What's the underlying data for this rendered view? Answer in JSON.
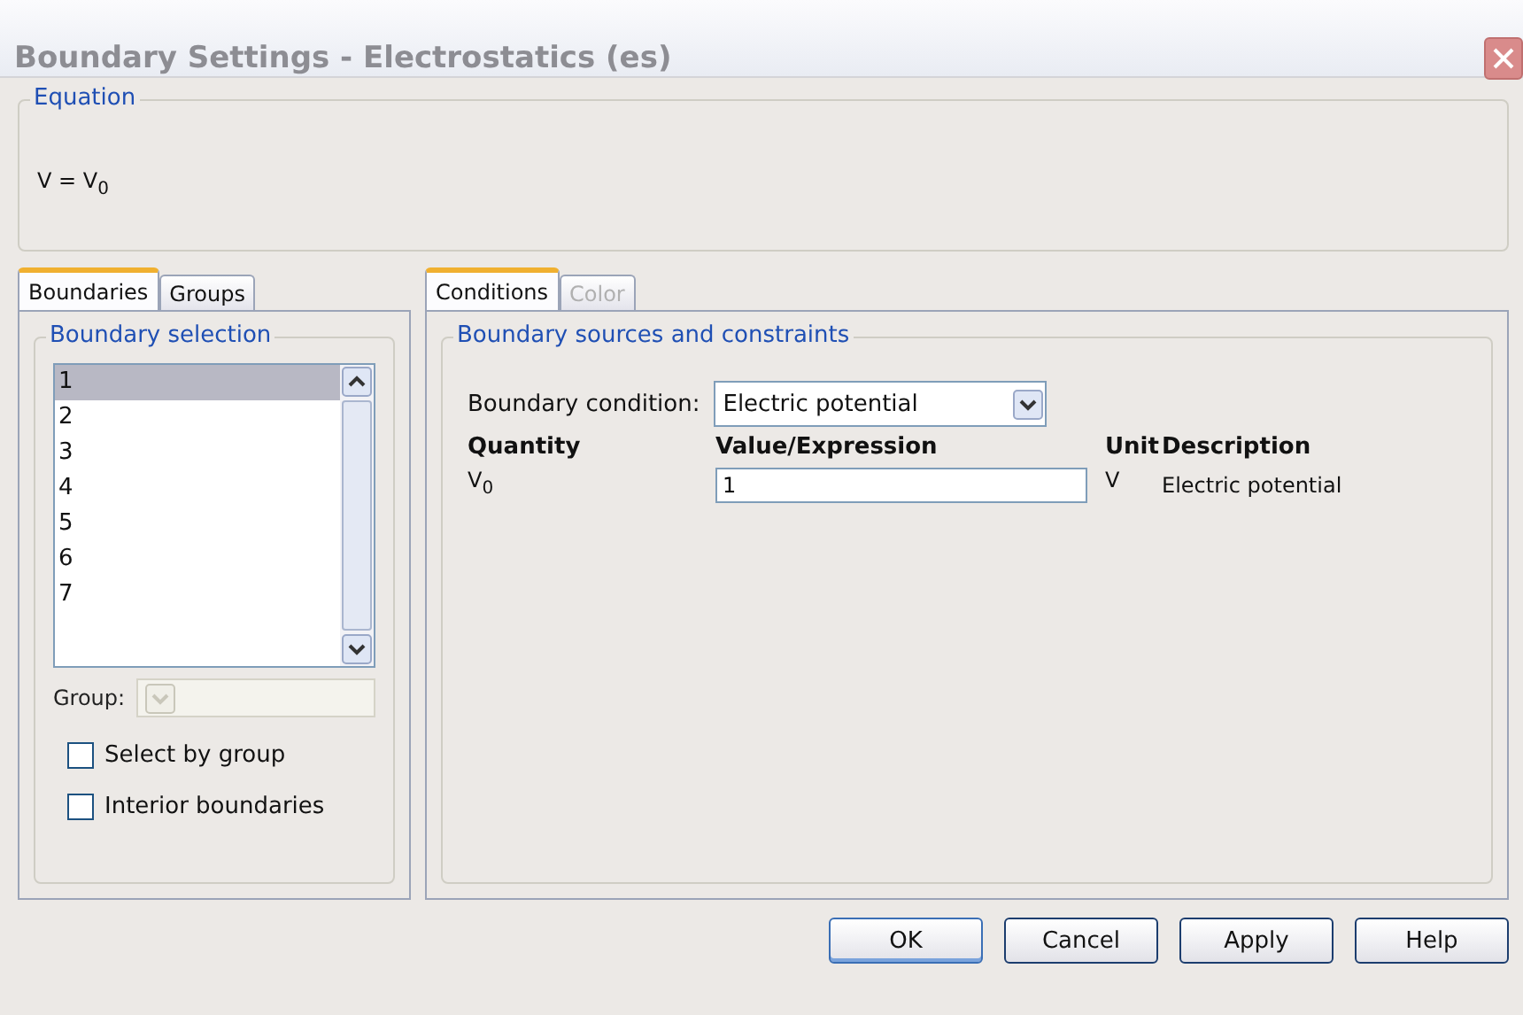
{
  "window": {
    "title": "Boundary Settings - Electrostatics (es)"
  },
  "equation": {
    "title": "Equation",
    "formula": "V = V$_{0}$"
  },
  "left_tabs": [
    {
      "label": "Boundaries",
      "selected": true,
      "disabled": false
    },
    {
      "label": "Groups",
      "selected": false,
      "disabled": false
    }
  ],
  "boundary_selection": {
    "title": "Boundary selection",
    "items": [
      {
        "label": "1",
        "selected": true
      },
      {
        "label": "2",
        "selected": false
      },
      {
        "label": "3",
        "selected": false
      },
      {
        "label": "4",
        "selected": false
      },
      {
        "label": "5",
        "selected": false
      },
      {
        "label": "6",
        "selected": false
      },
      {
        "label": "7",
        "selected": false
      }
    ],
    "group_label": "Group:",
    "group_disabled": true,
    "checkboxes": [
      {
        "label": "Select by group",
        "checked": false
      },
      {
        "label": "Interior boundaries",
        "checked": false
      }
    ]
  },
  "right_tabs": [
    {
      "label": "Conditions",
      "selected": true,
      "disabled": false
    },
    {
      "label": "Color",
      "selected": false,
      "disabled": true
    }
  ],
  "conditions": {
    "title": "Boundary sources and constraints",
    "condition_label": "Boundary condition:",
    "condition_value": "Electric potential",
    "columns": [
      "Quantity",
      "Value/Expression",
      "Unit",
      "Description"
    ],
    "rows": [
      {
        "quantity": "V$_{0}$",
        "value": "1",
        "unit": "V",
        "description": "Electric potential"
      }
    ]
  },
  "buttons": [
    {
      "label": "OK",
      "default": true
    },
    {
      "label": "Cancel",
      "default": false
    },
    {
      "label": "Apply",
      "default": false
    },
    {
      "label": "Help",
      "default": false
    }
  ]
}
